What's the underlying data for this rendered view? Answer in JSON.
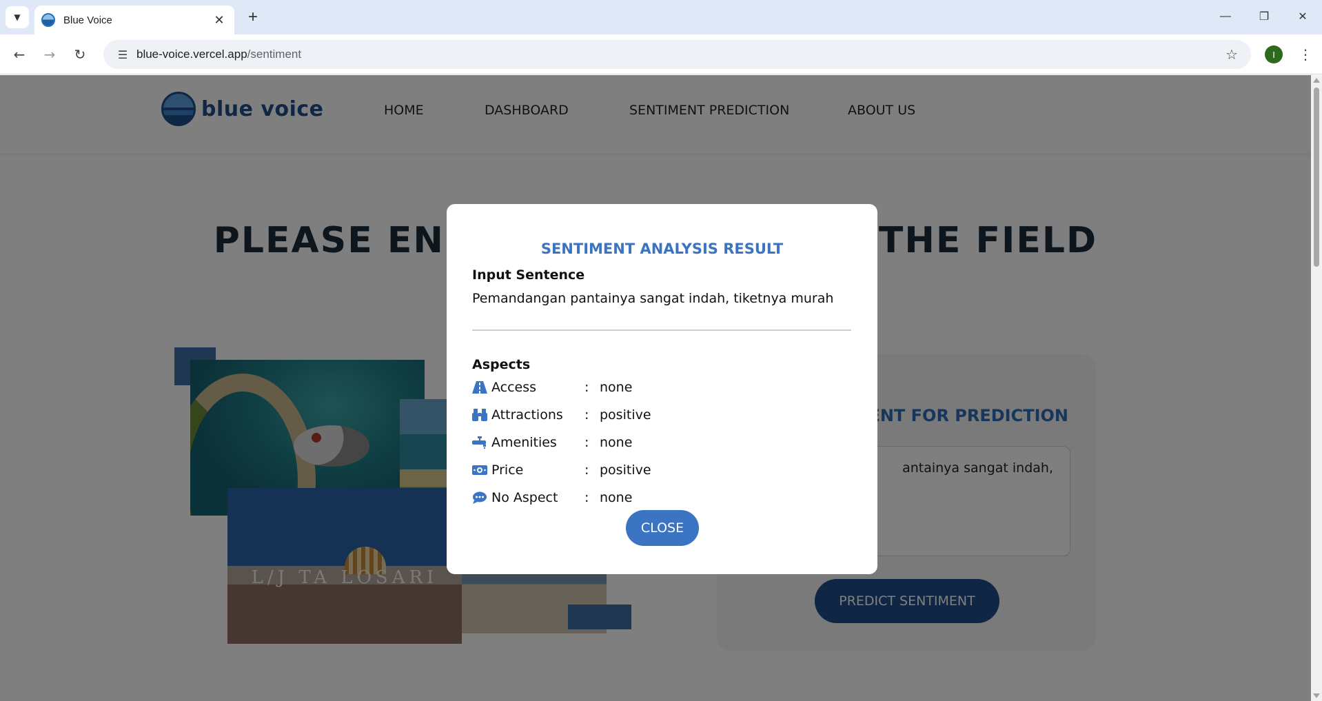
{
  "browser": {
    "tab_title": "Blue Voice",
    "url_host": "blue-voice.vercel.app",
    "url_path": "/sentiment",
    "profile_initial": "I"
  },
  "header": {
    "logo_text": "blue voice",
    "nav": [
      {
        "label": "HOME"
      },
      {
        "label": "DASHBOARD"
      },
      {
        "label": "SENTIMENT PREDICTION"
      },
      {
        "label": "ABOUT US"
      }
    ]
  },
  "hero": {
    "title_left": "PLEASE EN",
    "title_right": "THE FIELD"
  },
  "collage": {
    "sign_text": "L/J TA  LOSARI"
  },
  "form": {
    "heading_visible": "ENT FOR PREDICTION",
    "textarea_value_visible": "antainya sangat indah,",
    "predict_label": "PREDICT SENTIMENT"
  },
  "modal": {
    "title": "SENTIMENT ANALYSIS RESULT",
    "input_label": "Input Sentence",
    "input_sentence": "Pemandangan pantainya sangat indah, tiketnya murah",
    "aspects_label": "Aspects",
    "aspects": [
      {
        "icon": "road-icon",
        "name": "Access",
        "value": "none"
      },
      {
        "icon": "binoculars-icon",
        "name": "Attractions",
        "value": "positive"
      },
      {
        "icon": "faucet-icon",
        "name": "Amenities",
        "value": "none"
      },
      {
        "icon": "money-bill-icon",
        "name": "Price",
        "value": "positive"
      },
      {
        "icon": "comment-dots-icon",
        "name": "No Aspect",
        "value": "none"
      }
    ],
    "separator": ":",
    "close_label": "CLOSE"
  },
  "colors": {
    "brand_dark": "#1e4f8a",
    "brand_accent": "#3a74c2",
    "overlay": "rgba(0,0,0,0.5)"
  }
}
